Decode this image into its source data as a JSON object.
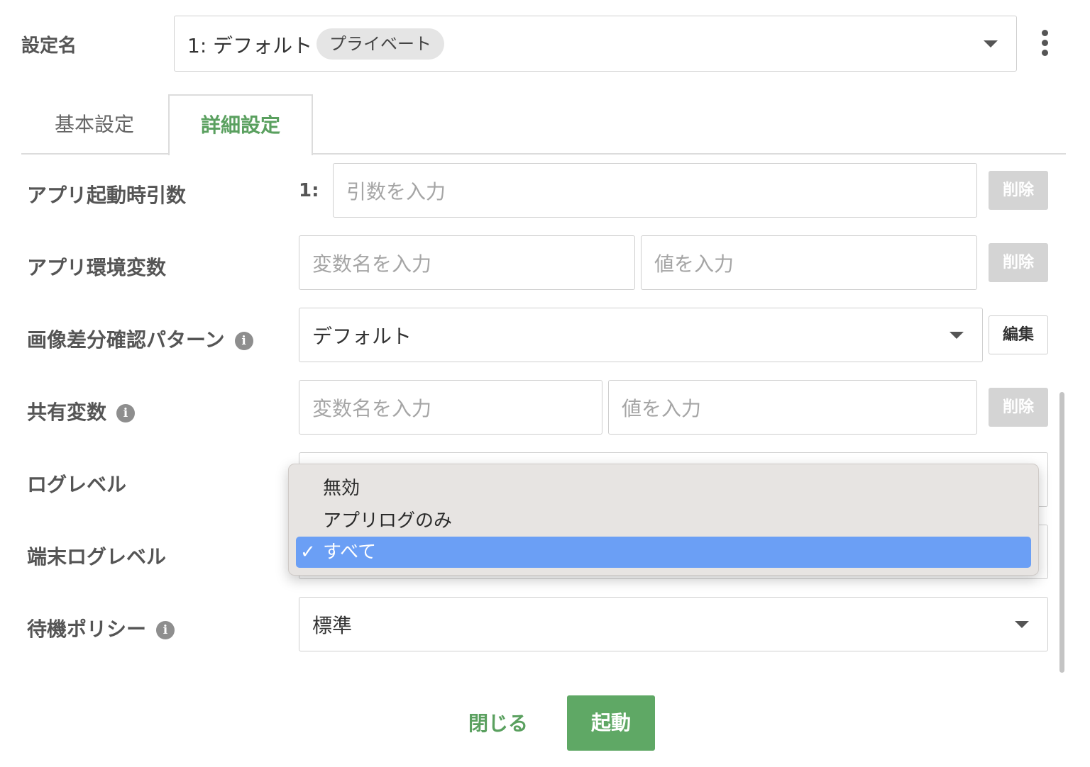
{
  "header": {
    "label": "設定名",
    "config_name": "1: デフォルト",
    "badge": "プライベート",
    "more_icon": "vertical-dots-icon"
  },
  "tabs": [
    {
      "label": "基本設定",
      "active": false
    },
    {
      "label": "詳細設定",
      "active": true
    }
  ],
  "app_args": {
    "label": "アプリ起動時引数",
    "index": "1:",
    "placeholder": "引数を入力",
    "delete_label": "削除"
  },
  "app_env": {
    "label": "アプリ環境変数",
    "name_placeholder": "変数名を入力",
    "value_placeholder": "値を入力",
    "delete_label": "削除"
  },
  "image_diff": {
    "label": "画像差分確認パターン",
    "value": "デフォルト",
    "edit_label": "編集"
  },
  "shared_vars": {
    "label": "共有変数",
    "name_placeholder": "変数名を入力",
    "value_placeholder": "値を入力",
    "delete_label": "削除"
  },
  "log_level": {
    "label": "ログレベル"
  },
  "device_log_level": {
    "label": "端末ログレベル"
  },
  "dropdown": {
    "options": [
      "無効",
      "アプリログのみ",
      "すべて"
    ],
    "selected_index": 2,
    "check": "✓"
  },
  "wait_policy": {
    "label": "待機ポリシー",
    "value": "標準"
  },
  "info_glyph": "i",
  "footer": {
    "close_label": "閉じる",
    "launch_label": "起動"
  },
  "colors": {
    "accent": "#5aa05f",
    "selected_option": "#6b9ff5",
    "disabled_button": "#d4d4d4"
  }
}
